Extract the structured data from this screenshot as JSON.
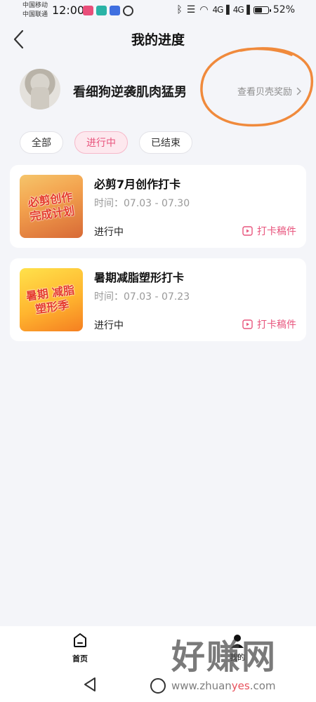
{
  "status_bar": {
    "carrier1": "中国移动",
    "carrier2": "中国联通",
    "time": "12:00",
    "signal1": "4G",
    "signal2": "4G",
    "battery": "52%"
  },
  "header": {
    "title": "我的进度"
  },
  "profile": {
    "username": "看细狗逆袭肌肉猛男",
    "rewards_link": "查看贝壳奖励"
  },
  "tabs": [
    {
      "label": "全部",
      "active": false
    },
    {
      "label": "进行中",
      "active": true
    },
    {
      "label": "已结束",
      "active": false
    }
  ],
  "cards": [
    {
      "title": "必剪7月创作打卡",
      "time": "时间：07.03 - 07.30",
      "status": "进行中",
      "action": "打卡稿件",
      "thumb_text": "必剪创作 完成计划"
    },
    {
      "title": "暑期减脂塑形打卡",
      "time": "时间：07.03 - 07.23",
      "status": "进行中",
      "action": "打卡稿件",
      "thumb_text": "暑期 减脂塑形季"
    }
  ],
  "bottom_nav": {
    "home_label": "首页",
    "me_label": "我的"
  },
  "watermark": {
    "big": "好赚网",
    "small_prefix": "www.zhuan",
    "small_red": "yes",
    "small_suffix": ".com"
  },
  "colors": {
    "accent": "#e8557d",
    "background": "#f4f5f9",
    "annotation": "#f08a3c"
  }
}
